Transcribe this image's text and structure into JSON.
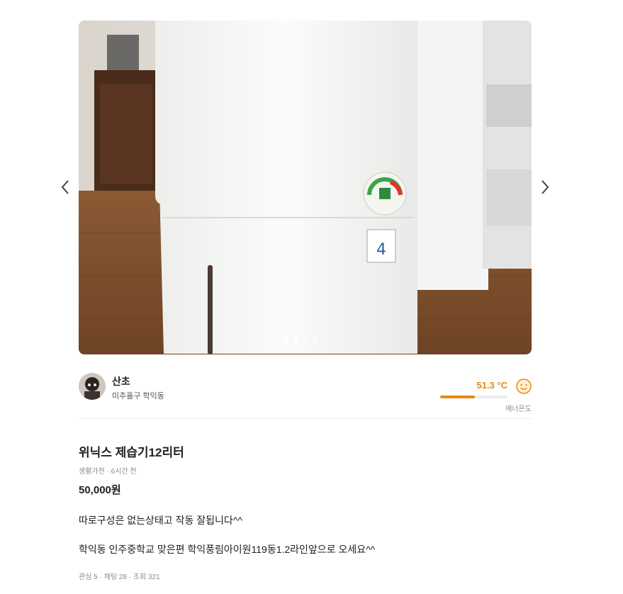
{
  "carousel": {
    "prev_icon": "chevron-left-icon",
    "next_icon": "chevron-right-icon",
    "slide_count": 5,
    "active_slide": 2
  },
  "seller": {
    "nickname": "산초",
    "region": "미추홀구 학익동",
    "temperature": "51.3 °C",
    "temperature_level": 0.513,
    "temperature_caption": "매너온도",
    "accent_color": "#e8890c"
  },
  "article": {
    "title": "위닉스 제습기12리터",
    "meta": "생활가전 · 6시간 전",
    "price": "50,000원",
    "description_lines": [
      "따로구성은 없는상태고 작동 잘됩니다^^",
      "학익동 인주중학교 맞은편 학익풍림아이원119동1.2라인앞으로 오세요^^"
    ],
    "counts": "관심 5 · 채팅 28 · 조회 321"
  }
}
